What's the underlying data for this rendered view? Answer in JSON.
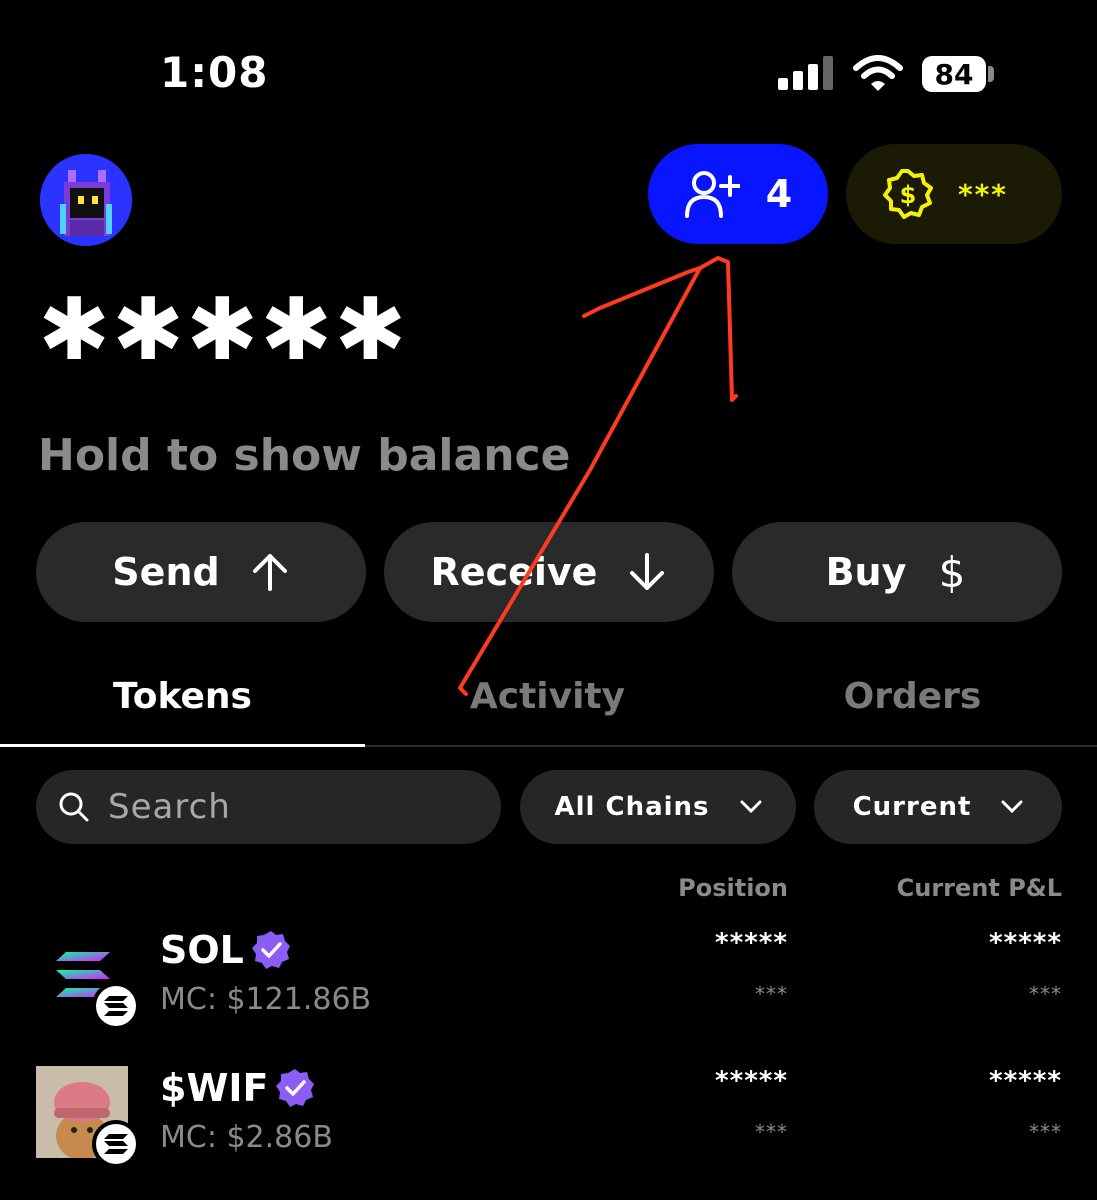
{
  "status_bar": {
    "time": "1:08",
    "battery": "84"
  },
  "header": {
    "referral_count": "4",
    "points_value": "***",
    "masked_name": "✱✱✱✱✱",
    "hold_hint": "Hold to show balance"
  },
  "actions": [
    {
      "label": "Send",
      "icon": "arrow-up-icon"
    },
    {
      "label": "Receive",
      "icon": "arrow-down-icon"
    },
    {
      "label": "Buy",
      "icon": "dollar-icon"
    }
  ],
  "tabs": [
    {
      "label": "Tokens",
      "active": true
    },
    {
      "label": "Activity",
      "active": false
    },
    {
      "label": "Orders",
      "active": false
    }
  ],
  "filters": {
    "search_placeholder": "Search",
    "chain_filter": "All Chains",
    "sort_filter": "Current"
  },
  "columns": {
    "position": "Position",
    "pnl": "Current P&L"
  },
  "tokens": [
    {
      "symbol": "SOL",
      "market_cap": "MC: $121.86B",
      "position": "*****",
      "position_sub": "***",
      "pnl": "*****",
      "pnl_sub": "***",
      "verified": true
    },
    {
      "symbol": "$WIF",
      "market_cap": "MC: $2.86B",
      "position": "*****",
      "position_sub": "***",
      "pnl": "*****",
      "pnl_sub": "***",
      "verified": true
    }
  ],
  "colors": {
    "referral_pill": "#0a15ff",
    "points_accent": "#f4f20a",
    "verified_badge": "#8b5cf6",
    "annotation_arrow": "#ff3b1f"
  }
}
